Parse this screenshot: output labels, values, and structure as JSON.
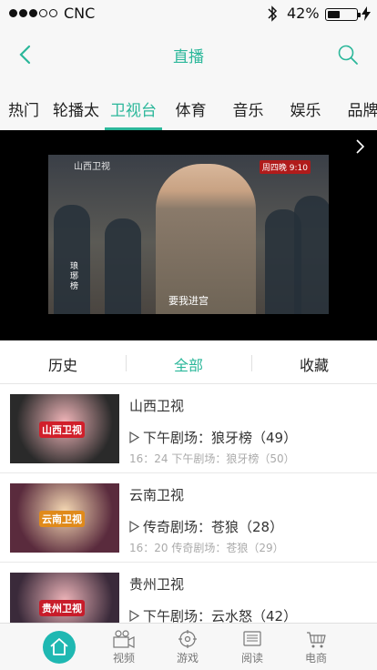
{
  "status": {
    "carrier": "CNC",
    "battery": "42%",
    "battery_level": 0.42
  },
  "header": {
    "title": "直播"
  },
  "tabs": [
    {
      "label": "热门"
    },
    {
      "label": "轮播太"
    },
    {
      "label": "卫视台"
    },
    {
      "label": "体育"
    },
    {
      "label": "音乐"
    },
    {
      "label": "娱乐"
    },
    {
      "label": "品牌"
    }
  ],
  "active_tab": "卫视台",
  "player": {
    "channel_logo": "山西卫视",
    "program_badge": "周四晚 9:10",
    "side_caption": "琅琊榜",
    "subtitle": "要我进宫"
  },
  "filters": [
    {
      "label": "历史"
    },
    {
      "label": "全部"
    },
    {
      "label": "收藏"
    }
  ],
  "active_filter": "全部",
  "channels": [
    {
      "name": "山西卫视",
      "now": "下午剧场：狼牙榜（49）",
      "next": "16：24 下午剧场：狼牙榜（50）",
      "logo": "山西卫视",
      "thumb_color": "#2a2a2a",
      "logo_color": "#d11f2a"
    },
    {
      "name": "云南卫视",
      "now": "传奇剧场：苍狼（28）",
      "next": "16：20 传奇剧场：苍狼（29）",
      "logo": "云南卫视",
      "thumb_color": "#5a2b3d",
      "logo_color": "#e08a1a"
    },
    {
      "name": "贵州卫视",
      "now": "下午剧场：云水怒（42）",
      "next": "",
      "logo": "贵州卫视",
      "thumb_color": "#3a2a3a",
      "logo_color": "#c81c2a"
    }
  ],
  "bottom_nav": [
    {
      "label": "视频",
      "icon": "video-icon"
    },
    {
      "label": "游戏",
      "icon": "game-icon"
    },
    {
      "label": "阅读",
      "icon": "book-icon"
    },
    {
      "label": "电商",
      "icon": "cart-icon"
    }
  ],
  "colors": {
    "accent": "#2bb79a",
    "home": "#1fb8b2"
  }
}
